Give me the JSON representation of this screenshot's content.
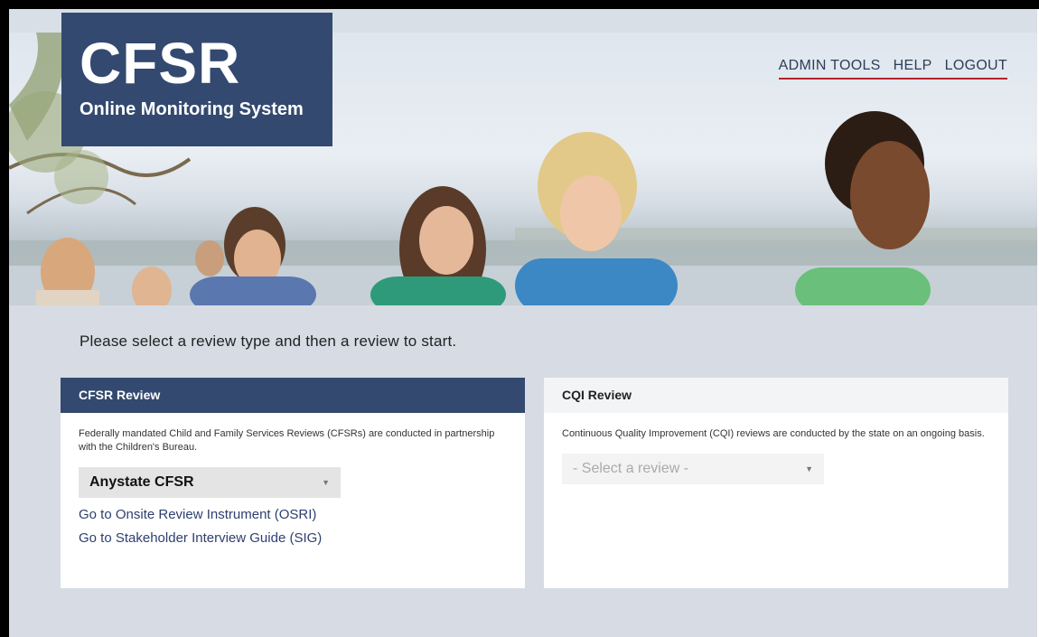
{
  "app": {
    "logo_title": "CFSR",
    "logo_subtitle": "Online Monitoring System"
  },
  "nav": [
    "ADMIN TOOLS",
    "HELP",
    "LOGOUT"
  ],
  "prompt": "Please select a review type and then a review to start.",
  "cfsr_card": {
    "title": "CFSR Review",
    "description": "Federally mandated Child and Family Services Reviews (CFSRs) are conducted in partnership with the Children's Bureau.",
    "selected": "Anystate CFSR",
    "links": [
      "Go to Onsite Review Instrument (OSRI)",
      "Go to Stakeholder Interview Guide (SIG)"
    ]
  },
  "cqi_card": {
    "title": "CQI Review",
    "description": "Continuous Quality Improvement (CQI) reviews are conducted by the state on an ongoing basis.",
    "placeholder": "- Select a review -"
  },
  "colors": {
    "brand_navy": "#33496f",
    "accent_red": "#b5232e",
    "link_blue": "#2e3f6f"
  }
}
